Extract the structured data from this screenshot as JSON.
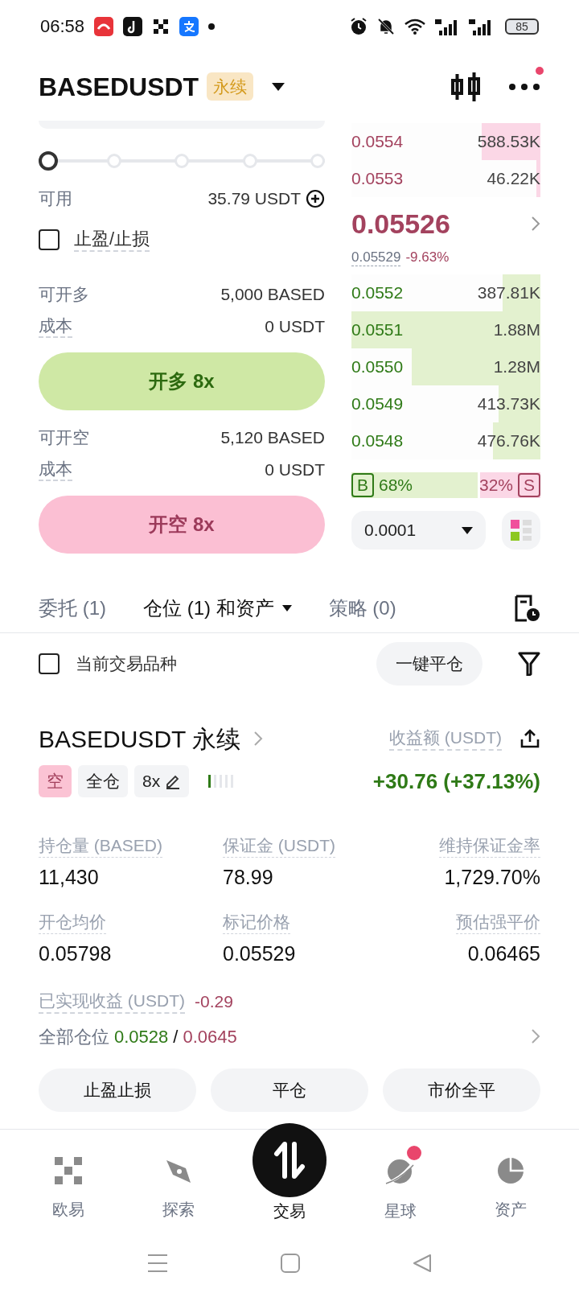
{
  "status_bar": {
    "time": "06:58",
    "battery": "85"
  },
  "header": {
    "symbol": "BASEDUSDT",
    "badge": "永续",
    "notification_dot": true
  },
  "order_form": {
    "slider": {
      "level": 0
    },
    "available": {
      "label": "可用",
      "value": "35.79 USDT"
    },
    "tp_sl": {
      "label": "止盈/止损",
      "checked": false
    },
    "long": {
      "max_label": "可开多",
      "max_value": "5,000 BASED",
      "cost_label": "成本",
      "cost_value": "0 USDT",
      "button": "开多 8x"
    },
    "short": {
      "max_label": "可开空",
      "max_value": "5,120 BASED",
      "cost_label": "成本",
      "cost_value": "0 USDT",
      "button": "开空 8x"
    }
  },
  "order_book": {
    "asks": [
      {
        "price": "0.0554",
        "amount": "588.53K",
        "level": 0.31
      },
      {
        "price": "0.0553",
        "amount": "46.22K",
        "level": 0.02
      }
    ],
    "last_price": "0.05526",
    "mark_price": "0.05529",
    "change": "-9.63%",
    "bids": [
      {
        "price": "0.0552",
        "amount": "387.81K",
        "level": 0.2
      },
      {
        "price": "0.0551",
        "amount": "1.88M",
        "level": 1
      },
      {
        "price": "0.0550",
        "amount": "1.28M",
        "level": 0.68
      },
      {
        "price": "0.0549",
        "amount": "413.73K",
        "level": 0.22
      },
      {
        "price": "0.0548",
        "amount": "476.76K",
        "level": 0.25
      }
    ],
    "buy_label": "B",
    "buy_percent": "68%",
    "sell_percent": "32%",
    "sell_label": "S",
    "ratio": {
      "level": 0.68
    },
    "precision": "0.0001"
  },
  "tabs": [
    {
      "label": "委托 (1)",
      "selected": false,
      "dropdown": false
    },
    {
      "label": "仓位 (1) 和资产",
      "selected": true,
      "dropdown": true
    },
    {
      "label": "策略 (0)",
      "selected": false,
      "dropdown": false
    }
  ],
  "filter": {
    "label": "当前交易品种",
    "checked": false,
    "close_all": "一键平仓"
  },
  "position": {
    "title": "BASEDUSDT 永续",
    "pnl_label": "收益额 (USDT)",
    "pnl": "+30.76 (+37.13%)",
    "tags": [
      {
        "text": "空",
        "kind": "side"
      },
      {
        "text": "全仓",
        "kind": "plain"
      },
      {
        "text": "8x",
        "kind": "leverage"
      }
    ],
    "risk": {
      "level": 0.2
    },
    "fields": [
      {
        "label": "持仓量 (BASED)",
        "value": "11,430"
      },
      {
        "label": "保证金 (USDT)",
        "value": "78.99"
      },
      {
        "label": "维持保证金率",
        "value": "1,729.70%"
      },
      {
        "label": "开仓均价",
        "value": "0.05798"
      },
      {
        "label": "标记价格",
        "value": "0.05529"
      },
      {
        "label": "预估强平价",
        "value": "0.06465"
      }
    ],
    "realized_label": "已实现收益 (USDT)",
    "realized_value": "-0.29",
    "all_label": "全部仓位",
    "all_low": "0.0528",
    "all_sep": "/",
    "all_high": "0.0645",
    "actions": [
      "止盈止损",
      "平仓",
      "市价全平"
    ]
  },
  "bottom_nav": [
    {
      "label": "欧易",
      "kind": "home",
      "selected": false,
      "badge": false
    },
    {
      "label": "探索",
      "kind": "explore",
      "selected": false,
      "badge": false
    },
    {
      "label": "交易",
      "kind": "trade",
      "selected": true,
      "badge": false
    },
    {
      "label": "星球",
      "kind": "planet",
      "selected": false,
      "badge": true
    },
    {
      "label": "资产",
      "kind": "assets",
      "selected": false,
      "badge": false
    }
  ]
}
